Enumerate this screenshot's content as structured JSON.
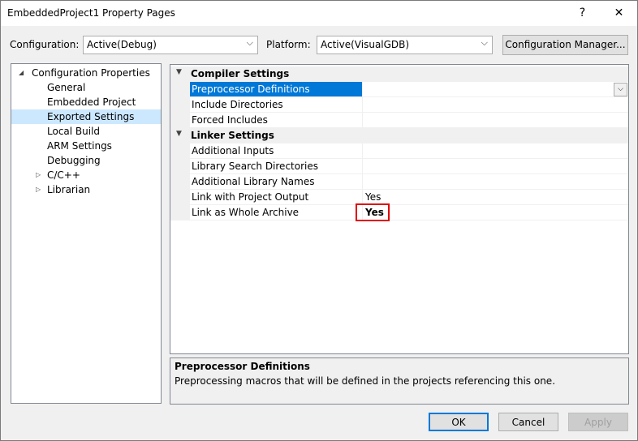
{
  "window": {
    "title": "EmbeddedProject1 Property Pages",
    "help_glyph": "?",
    "close_glyph": "✕"
  },
  "toolbar": {
    "configuration_label": "Configuration:",
    "configuration_value": "Active(Debug)",
    "platform_label": "Platform:",
    "platform_value": "Active(VisualGDB)",
    "config_manager_button": "Configuration Manager..."
  },
  "tree": {
    "root": "Configuration Properties",
    "items": [
      {
        "label": "General"
      },
      {
        "label": "Embedded Project"
      },
      {
        "label": "Exported Settings",
        "selected": true
      },
      {
        "label": "Local Build"
      },
      {
        "label": "ARM Settings"
      },
      {
        "label": "Debugging"
      },
      {
        "label": "C/C++",
        "collapsed": true
      },
      {
        "label": "Librarian",
        "collapsed": true
      }
    ]
  },
  "grid": {
    "categories": [
      {
        "label": "Compiler Settings",
        "properties": [
          {
            "name": "Preprocessor Definitions",
            "value": "",
            "selected": true
          },
          {
            "name": "Include Directories",
            "value": ""
          },
          {
            "name": "Forced Includes",
            "value": ""
          }
        ]
      },
      {
        "label": "Linker Settings",
        "properties": [
          {
            "name": "Additional Inputs",
            "value": ""
          },
          {
            "name": "Library Search Directories",
            "value": ""
          },
          {
            "name": "Additional Library Names",
            "value": ""
          },
          {
            "name": "Link with Project Output",
            "value": "Yes"
          },
          {
            "name": "Link as Whole Archive",
            "value": "Yes",
            "bold": true,
            "highlighted": true
          }
        ]
      }
    ]
  },
  "description": {
    "title": "Preprocessor Definitions",
    "text": "Preprocessing macros that will be defined in the projects referencing this one."
  },
  "buttons": {
    "ok": "OK",
    "cancel": "Cancel",
    "apply": "Apply"
  },
  "colors": {
    "selection": "#0078d7",
    "tree_selection": "#cce8ff",
    "highlight_box": "#e00000"
  }
}
